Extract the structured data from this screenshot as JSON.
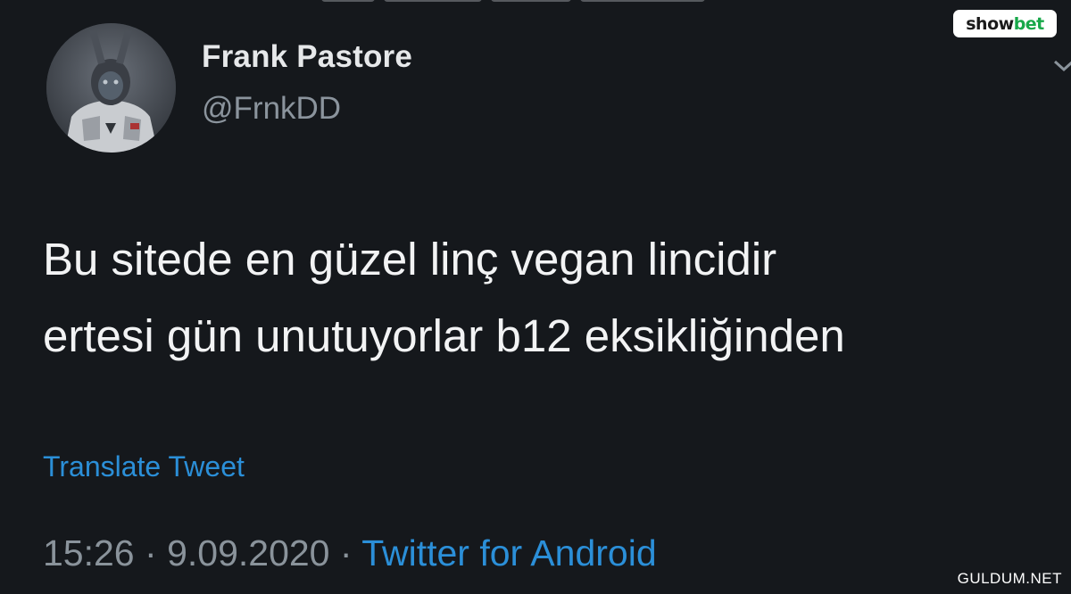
{
  "tweet": {
    "display_name": "Frank Pastore",
    "handle": "@FrnkDD",
    "text_lines": [
      "Bu sitede en güzel linç vegan lincidir",
      "ertesi gün unutuyorlar b12 eksikliğinden"
    ],
    "translate_label": "Translate Tweet",
    "time": "15:26",
    "separator": "·",
    "date": "9.09.2020",
    "source": "Twitter for Android"
  },
  "watermarks": {
    "brand_left": "show",
    "brand_right": "bet",
    "site": "GULDUM.NET"
  },
  "icons": {
    "menu": "chevron-down-icon",
    "avatar": "avatar-astronaut-image"
  },
  "colors": {
    "background": "#15181c",
    "link": "#2b8fd8",
    "muted": "#8a939b",
    "text": "#f2f3f4",
    "brand_green": "#18a84a"
  }
}
